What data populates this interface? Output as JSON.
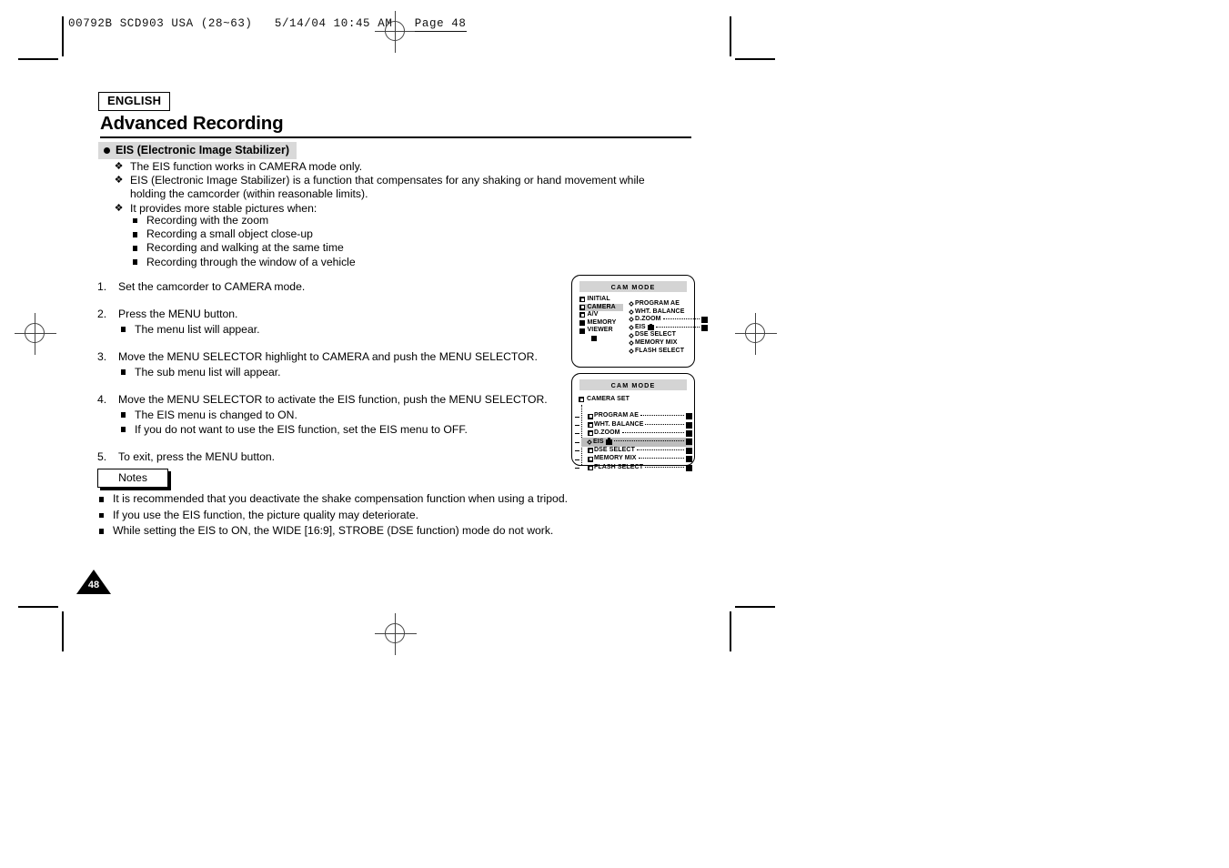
{
  "print_header": {
    "job": "00792B SCD903 USA (28~63)",
    "datetime": "5/14/04 10:45 AM",
    "page_label": "Page 48"
  },
  "document": {
    "language_badge": "ENGLISH",
    "chapter_title": "Advanced Recording",
    "section_title": "EIS (Electronic Image Stabilizer)",
    "page_number": "48"
  },
  "intro_bullets": [
    "The EIS function works in CAMERA mode only.",
    "EIS (Electronic Image Stabilizer) is a function that compensates for any shaking or hand movement while holding the camcorder (within reasonable limits).",
    "It provides more stable pictures when:"
  ],
  "sub_bullets": [
    "Recording with the zoom",
    "Recording a small object close-up",
    "Recording and walking at the same time",
    "Recording through the window of a vehicle"
  ],
  "steps": [
    {
      "num": "1.",
      "text": "Set the camcorder to CAMERA mode.",
      "subs": []
    },
    {
      "num": "2.",
      "text": "Press the MENU button.",
      "subs": [
        "The menu list will appear."
      ]
    },
    {
      "num": "3.",
      "text": "Move the MENU SELECTOR highlight to CAMERA and push the MENU SELECTOR.",
      "subs": [
        "The sub menu list will appear."
      ]
    },
    {
      "num": "4.",
      "text": "Move the MENU SELECTOR to activate the EIS function, push the MENU SELECTOR.",
      "subs": [
        "The EIS menu is changed to ON.",
        "If you do not want to use the EIS function, set the EIS menu to OFF."
      ]
    },
    {
      "num": "5.",
      "text": "To exit, press the MENU button.",
      "subs": []
    }
  ],
  "notes": {
    "label": "Notes",
    "items": [
      "It is recommended that you deactivate the shake compensation function when using a tripod.",
      "If you use the EIS function, the picture quality may deteriorate.",
      "While setting the EIS to ON, the WIDE [16:9], STROBE (DSE function) mode do not work."
    ]
  },
  "lcd_main_menu": {
    "title": "CAM MODE",
    "left_items": [
      {
        "label": "INITIAL",
        "selected": false
      },
      {
        "label": "CAMERA",
        "selected": true
      },
      {
        "label": "A/V",
        "selected": false
      },
      {
        "label": "MEMORY",
        "selected": false
      },
      {
        "label": "VIEWER",
        "selected": false
      }
    ],
    "right_items": [
      {
        "label": "PROGRAM AE",
        "leader": false,
        "swatch": false
      },
      {
        "label": "WHT. BALANCE",
        "leader": false,
        "swatch": false
      },
      {
        "label": "D.ZOOM",
        "leader": true,
        "swatch": true
      },
      {
        "label": "EIS",
        "leader": true,
        "swatch": true,
        "cursor": true
      },
      {
        "label": "DSE SELECT",
        "leader": false,
        "swatch": false
      },
      {
        "label": "MEMORY MIX",
        "leader": false,
        "swatch": false
      },
      {
        "label": "FLASH SELECT",
        "leader": false,
        "swatch": false
      }
    ]
  },
  "lcd_sub_menu": {
    "title": "CAM MODE",
    "heading": "CAMERA SET",
    "items": [
      {
        "label": "PROGRAM AE",
        "selected": false
      },
      {
        "label": "WHT. BALANCE",
        "selected": false
      },
      {
        "label": "D.ZOOM",
        "selected": false
      },
      {
        "label": "EIS",
        "selected": true
      },
      {
        "label": "DSE SELECT",
        "selected": false
      },
      {
        "label": "MEMORY MIX",
        "selected": false
      },
      {
        "label": "FLASH SELECT",
        "selected": false
      }
    ]
  }
}
